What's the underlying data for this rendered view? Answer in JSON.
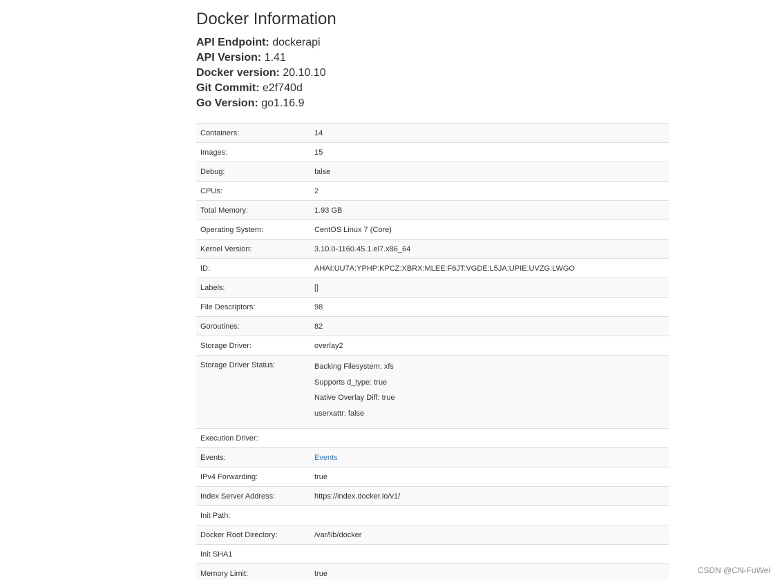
{
  "title": "Docker Information",
  "summary": [
    {
      "key": "API Endpoint:",
      "value": "dockerapi"
    },
    {
      "key": "API Version:",
      "value": "1.41"
    },
    {
      "key": "Docker version:",
      "value": "20.10.10"
    },
    {
      "key": "Git Commit:",
      "value": "e2f740d"
    },
    {
      "key": "Go Version:",
      "value": "go1.16.9"
    }
  ],
  "rows": [
    {
      "label": "Containers:",
      "value": "14"
    },
    {
      "label": "Images:",
      "value": "15"
    },
    {
      "label": "Debug:",
      "value": "false"
    },
    {
      "label": "CPUs:",
      "value": "2"
    },
    {
      "label": "Total Memory:",
      "value": "1.93 GB"
    },
    {
      "label": "Operating System:",
      "value": "CentOS Linux 7 (Core)"
    },
    {
      "label": "Kernel Version:",
      "value": "3.10.0-1160.45.1.el7.x86_64"
    },
    {
      "label": "ID:",
      "value": "AHAI:UU7A:YPHP:KPCZ:XBRX:MLEE:F6JT:VGDE:L5JA:UPIE:UVZG:LWGO"
    },
    {
      "label": "Labels:",
      "value": "[]"
    },
    {
      "label": "File Descriptors:",
      "value": "98"
    },
    {
      "label": "Goroutines:",
      "value": "82"
    },
    {
      "label": "Storage Driver:",
      "value": "overlay2"
    },
    {
      "label": "Storage Driver Status:",
      "lines": [
        "Backing Filesystem: xfs",
        "Supports d_type: true",
        "Native Overlay Diff: true",
        "userxattr: false"
      ]
    },
    {
      "label": "Execution Driver:",
      "value": ""
    },
    {
      "label": "Events:",
      "value": "Events",
      "link": true
    },
    {
      "label": "IPv4 Forwarding:",
      "value": "true"
    },
    {
      "label": "Index Server Address:",
      "value": "https://index.docker.io/v1/"
    },
    {
      "label": "Init Path:",
      "value": ""
    },
    {
      "label": "Docker Root Directory:",
      "value": "/var/lib/docker"
    },
    {
      "label": "Init SHA1",
      "value": ""
    },
    {
      "label": "Memory Limit:",
      "value": "true"
    }
  ],
  "watermark": "CSDN @CN-FuWei",
  "colors": {
    "link": "#337ab7",
    "stripe": "#f9f9f9",
    "border": "#dddddd"
  }
}
